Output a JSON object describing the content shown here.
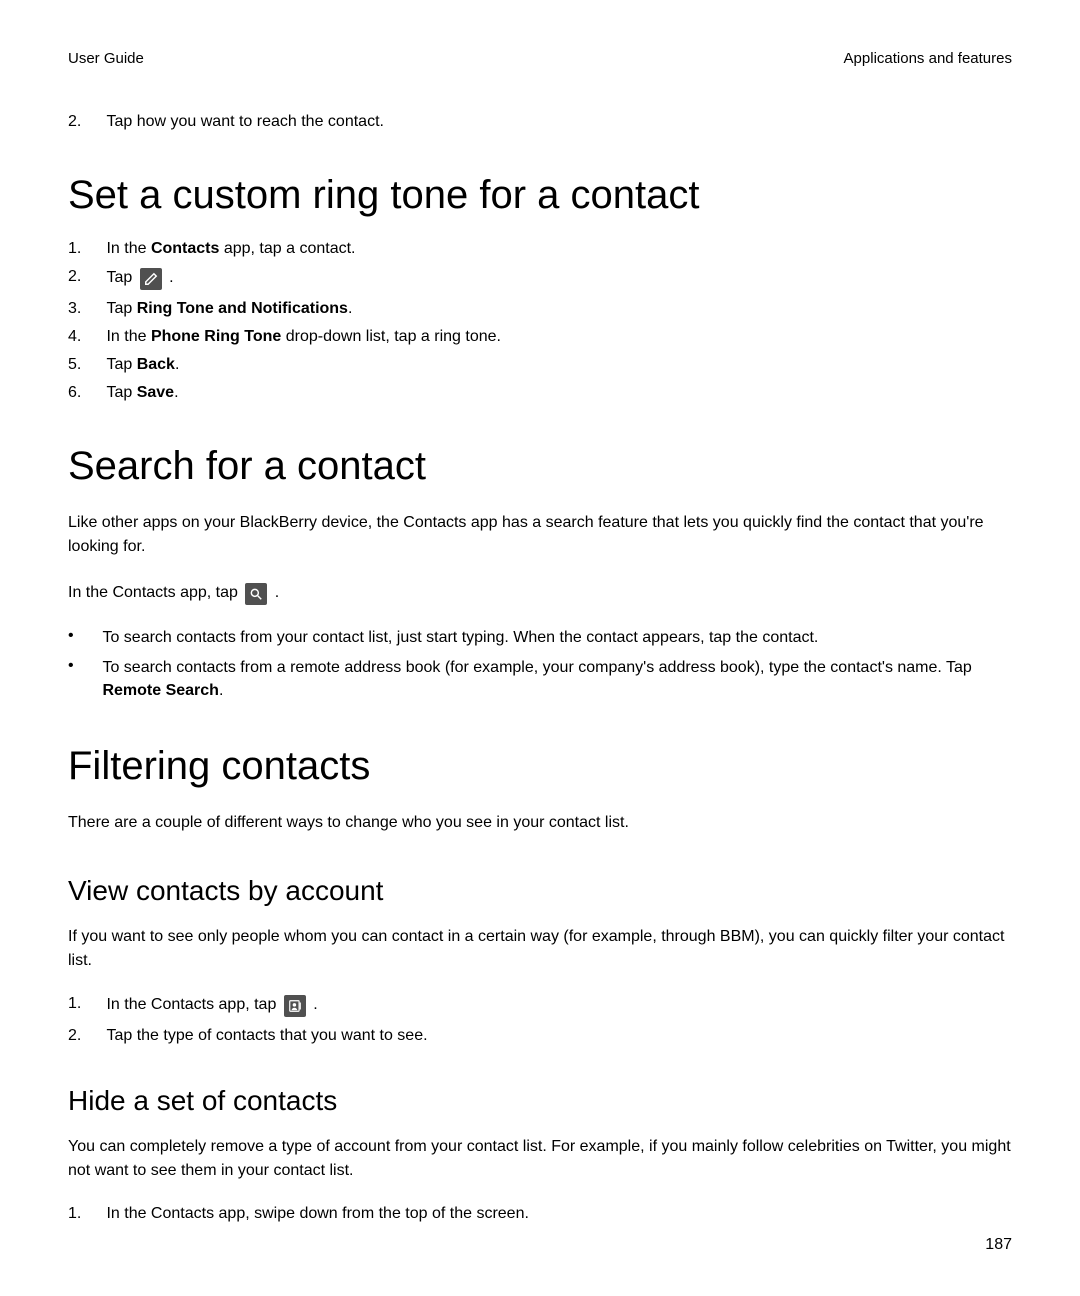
{
  "header": {
    "left": "User Guide",
    "right": "Applications and features"
  },
  "top_list": {
    "num": "2.",
    "text": "Tap how you want to reach the contact."
  },
  "ringtone": {
    "heading": "Set a custom ring tone for a contact",
    "steps": [
      {
        "num": "1.",
        "parts": [
          "In the ",
          "Contacts",
          " app, tap a contact."
        ]
      },
      {
        "num": "2.",
        "parts": [
          "Tap ",
          "ICON",
          " ."
        ]
      },
      {
        "num": "3.",
        "parts": [
          "Tap ",
          "Ring Tone and Notifications",
          "."
        ]
      },
      {
        "num": "4.",
        "parts": [
          "In the ",
          "Phone Ring Tone",
          " drop-down list, tap a ring tone."
        ]
      },
      {
        "num": "5.",
        "parts": [
          "Tap ",
          "Back",
          "."
        ]
      },
      {
        "num": "6.",
        "parts": [
          "Tap ",
          "Save",
          "."
        ]
      }
    ]
  },
  "search": {
    "heading": "Search for a contact",
    "para1": "Like other apps on your BlackBerry device, the Contacts app has a search feature that lets you quickly find the contact that you're looking for.",
    "para2_pre": "In the Contacts app, tap ",
    "para2_post": " .",
    "bullets": [
      {
        "text": "To search contacts from your contact list, just start typing. When the contact appears, tap the contact."
      },
      {
        "pre": "To search contacts from a remote address book (for example, your company's address book), type the contact's name. Tap ",
        "bold": "Remote Search",
        "post": "."
      }
    ]
  },
  "filtering": {
    "heading": "Filtering contacts",
    "para": "There are a couple of different ways to change who you see in your contact list.",
    "view": {
      "heading": "View contacts by account",
      "para": "If you want to see only people whom you can contact in a certain way (for example, through BBM), you can quickly filter your contact list.",
      "steps": [
        {
          "num": "1.",
          "pre": "In the Contacts app, tap ",
          "post": " ."
        },
        {
          "num": "2.",
          "text": "Tap the type of contacts that you want to see."
        }
      ]
    },
    "hide": {
      "heading": "Hide a set of contacts",
      "para": "You can completely remove a type of account from your contact list. For example, if you mainly follow celebrities on Twitter, you might not want to see them in your contact list.",
      "steps": [
        {
          "num": "1.",
          "text": "In the Contacts app, swipe down from the top of the screen."
        }
      ]
    }
  },
  "page_number": "187"
}
